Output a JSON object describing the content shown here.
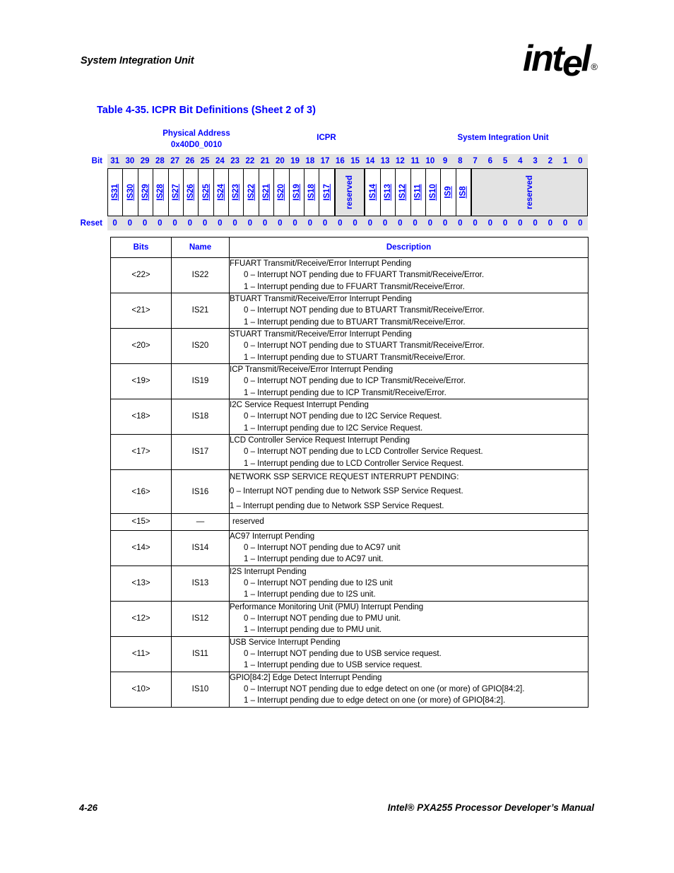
{
  "page": {
    "running_head": "System Integration Unit",
    "table_caption": "Table 4-35. ICPR Bit Definitions (Sheet 2 of 3)",
    "footer_page_number": "4-26",
    "footer_title": "Intel® PXA255 Processor Developer’s Manual",
    "accent_color": "#0000ff",
    "shade_color": "#e3e3e3"
  },
  "logo": {
    "text_part1": "int",
    "text_part2": "e",
    "text_part3": "l",
    "registered_mark": "®"
  },
  "register_diagram": {
    "physical_address_label": "Physical Address",
    "physical_address_value": "0x40D0_0010",
    "register_name": "ICPR",
    "unit_name": "System Integration Unit",
    "bit_row_label": "Bit",
    "reset_row_label": "Reset",
    "bit_numbers": [
      "31",
      "30",
      "29",
      "28",
      "27",
      "26",
      "25",
      "24",
      "23",
      "22",
      "21",
      "20",
      "19",
      "18",
      "17",
      "16",
      "15",
      "14",
      "13",
      "12",
      "11",
      "10",
      "9",
      "8",
      "7",
      "6",
      "5",
      "4",
      "3",
      "2",
      "1",
      "0"
    ],
    "reset_values": [
      "0",
      "0",
      "0",
      "0",
      "0",
      "0",
      "0",
      "0",
      "0",
      "0",
      "0",
      "0",
      "0",
      "0",
      "0",
      "0",
      "0",
      "0",
      "0",
      "0",
      "0",
      "0",
      "0",
      "0",
      "0",
      "0",
      "0",
      "0",
      "0",
      "0",
      "0",
      "0"
    ],
    "fields": [
      {
        "label": "IS31",
        "span": 1,
        "reserved": false
      },
      {
        "label": "IS30",
        "span": 1,
        "reserved": false
      },
      {
        "label": "IS29",
        "span": 1,
        "reserved": false
      },
      {
        "label": "IS28",
        "span": 1,
        "reserved": false
      },
      {
        "label": "IS27",
        "span": 1,
        "reserved": false
      },
      {
        "label": "IS26",
        "span": 1,
        "reserved": false
      },
      {
        "label": "IS25",
        "span": 1,
        "reserved": false
      },
      {
        "label": "IS24",
        "span": 1,
        "reserved": false
      },
      {
        "label": "IS23",
        "span": 1,
        "reserved": false
      },
      {
        "label": "IS22",
        "span": 1,
        "reserved": false
      },
      {
        "label": "IS21",
        "span": 1,
        "reserved": false
      },
      {
        "label": "IS20",
        "span": 1,
        "reserved": false
      },
      {
        "label": "IS19",
        "span": 1,
        "reserved": false
      },
      {
        "label": "IS18",
        "span": 1,
        "reserved": false
      },
      {
        "label": "IS17",
        "span": 1,
        "reserved": false
      },
      {
        "label": "reserved",
        "span": 2,
        "reserved": true
      },
      {
        "label": "IS14",
        "span": 1,
        "reserved": false
      },
      {
        "label": "IS13",
        "span": 1,
        "reserved": false
      },
      {
        "label": "IS12",
        "span": 1,
        "reserved": false
      },
      {
        "label": "IS11",
        "span": 1,
        "reserved": false
      },
      {
        "label": "IS10",
        "span": 1,
        "reserved": false
      },
      {
        "label": "IS9",
        "span": 1,
        "reserved": false
      },
      {
        "label": "IS8",
        "span": 1,
        "reserved": false
      },
      {
        "label": "reserved",
        "span": 8,
        "reserved": true
      }
    ]
  },
  "definitions_table": {
    "headers": {
      "bits": "Bits",
      "name": "Name",
      "description": "Description"
    },
    "rows": [
      {
        "bits": "<22>",
        "name": "IS22",
        "title": "FFUART Transmit/Receive/Error Interrupt Pending",
        "opt0": "0 –  Interrupt NOT pending due to FFUART Transmit/Receive/Error.",
        "opt1": "1 –  Interrupt pending due to FFUART Transmit/Receive/Error.",
        "style": "normal"
      },
      {
        "bits": "<21>",
        "name": "IS21",
        "title": "BTUART Transmit/Receive/Error Interrupt Pending",
        "opt0": "0 –  Interrupt NOT pending due to BTUART Transmit/Receive/Error.",
        "opt1": "1 –  Interrupt pending due to BTUART Transmit/Receive/Error.",
        "style": "normal"
      },
      {
        "bits": "<20>",
        "name": "IS20",
        "title": "STUART Transmit/Receive/Error Interrupt Pending",
        "opt0": "0 –  Interrupt NOT pending due to STUART Transmit/Receive/Error.",
        "opt1": "1 –  Interrupt pending due to STUART Transmit/Receive/Error.",
        "style": "normal"
      },
      {
        "bits": "<19>",
        "name": "IS19",
        "title": "ICP Transmit/Receive/Error Interrupt Pending",
        "opt0": "0 –  Interrupt NOT pending due to ICP Transmit/Receive/Error.",
        "opt1": "1 –  Interrupt pending due to ICP Transmit/Receive/Error.",
        "style": "normal"
      },
      {
        "bits": "<18>",
        "name": "IS18",
        "title": "I2C Service Request Interrupt Pending",
        "opt0": "0 –  Interrupt NOT pending due to I2C Service Request.",
        "opt1": "1 –  Interrupt pending due to I2C Service Request.",
        "style": "normal"
      },
      {
        "bits": "<17>",
        "name": "IS17",
        "title": "LCD Controller Service Request Interrupt Pending",
        "opt0": "0 –  Interrupt NOT pending due to LCD Controller Service Request.",
        "opt1": "1 –  Interrupt pending due to LCD Controller Service Request.",
        "style": "normal"
      },
      {
        "bits": "<16>",
        "name": "IS16",
        "title": "NETWORK SSP SERVICE REQUEST INTERRUPT PENDING:",
        "opt0": "0 – Interrupt NOT pending due to Network SSP Service Request.",
        "opt1": "1 – Interrupt pending due to Network SSP Service Request.",
        "style": "variant"
      },
      {
        "bits": "<15>",
        "name": "—",
        "title": "reserved",
        "opt0": "",
        "opt1": "",
        "style": "single"
      },
      {
        "bits": "<14>",
        "name": "IS14",
        "title": "AC97 Interrupt Pending",
        "opt0": "0 –  Interrupt NOT pending due to AC97 unit",
        "opt1": "1 –  Interrupt pending due to AC97 unit.",
        "style": "normal"
      },
      {
        "bits": "<13>",
        "name": "IS13",
        "title": "I2S Interrupt Pending",
        "opt0": "0 –  Interrupt NOT pending due to I2S unit",
        "opt1": "1 –  Interrupt pending due to I2S unit.",
        "style": "normal"
      },
      {
        "bits": "<12>",
        "name": "IS12",
        "title": "Performance Monitoring Unit (PMU) Interrupt Pending",
        "opt0": "0 –  Interrupt NOT pending due to PMU unit.",
        "opt1": "1 –  Interrupt pending due to PMU unit.",
        "style": "normal"
      },
      {
        "bits": "<11>",
        "name": "IS11",
        "title": "USB Service Interrupt Pending",
        "opt0": "0 –  Interrupt NOT pending due to USB service request.",
        "opt1": "1 –  Interrupt pending due to USB service request.",
        "style": "normal"
      },
      {
        "bits": "<10>",
        "name": "IS10",
        "title": "GPIO[84:2] Edge Detect Interrupt Pending",
        "opt0": "0 –  Interrupt NOT pending due to edge detect on one (or more) of GPIO[84:2].",
        "opt1": "1 –  Interrupt pending due to edge detect on one (or more) of GPIO[84:2].",
        "style": "normal"
      }
    ]
  }
}
